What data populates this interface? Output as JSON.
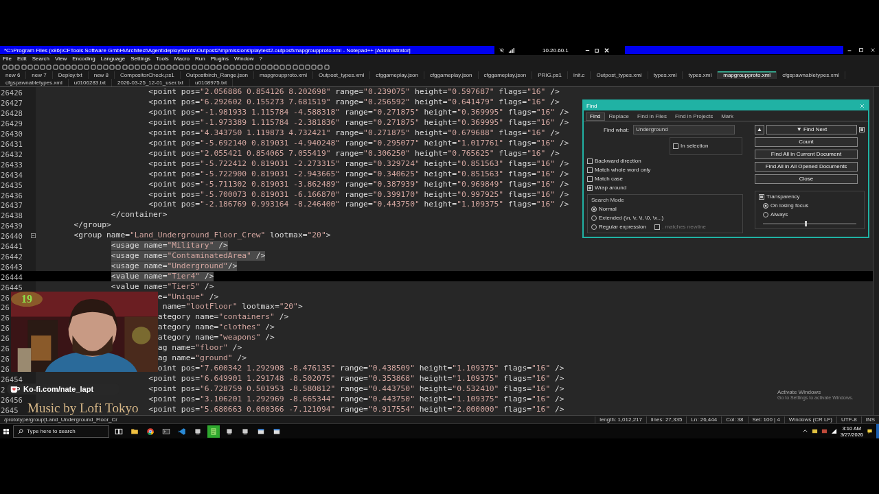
{
  "window": {
    "title": "*C:\\Program Files (x86)\\CFTools Software GmbH\\Architect\\Agent\\deployments\\Outpost2\\mpmissions\\playtest2.outpost\\mapgroupproto.xml - Notepad++ [Administrator]"
  },
  "remote_bar": {
    "address": "10.20.60.1"
  },
  "menu": [
    "File",
    "Edit",
    "Search",
    "View",
    "Encoding",
    "Language",
    "Settings",
    "Tools",
    "Macro",
    "Run",
    "Plugins",
    "Window",
    "?"
  ],
  "tabs": [
    {
      "label": "new 6",
      "selected": false
    },
    {
      "label": "new 7",
      "selected": false
    },
    {
      "label": "Deploy.txt",
      "selected": false
    },
    {
      "label": "new 8",
      "selected": false
    },
    {
      "label": "CompositorCheck.ps1",
      "selected": false
    },
    {
      "label": "Outpostbirch_Range.json",
      "selected": false
    },
    {
      "label": "mapgroupproto.xml",
      "selected": false
    },
    {
      "label": "Outpost_types.xml",
      "selected": false
    },
    {
      "label": "cfggameplay.json",
      "selected": false
    },
    {
      "label": "cfggameplay.json",
      "selected": false
    },
    {
      "label": "cfggameplay.json",
      "selected": false
    },
    {
      "label": "PRIG.ps1",
      "selected": false
    },
    {
      "label": "init.c",
      "selected": false
    },
    {
      "label": "Outpost_types.xml",
      "selected": false
    },
    {
      "label": "types.xml",
      "selected": false
    },
    {
      "label": "types.xml",
      "selected": false
    },
    {
      "label": "mapgroupproto.xml",
      "selected": true
    },
    {
      "label": "cfgspawnabletypes.xml",
      "selected": false
    },
    {
      "label": "cfgspawnabletypes.xml",
      "selected": false
    },
    {
      "label": "u0106283.txt",
      "selected": false
    },
    {
      "label": "2026-03-25_12-01_user.txt",
      "selected": false
    },
    {
      "label": "u0108975.txt",
      "selected": false
    }
  ],
  "lines": [
    {
      "n": "26426",
      "text": "                        <point pos=\"2.056886 0.854126 8.202698\" range=\"0.239075\" height=\"0.597687\" flags=\"16\" />",
      "selected": false,
      "current": false,
      "fold": false
    },
    {
      "n": "26427",
      "text": "                        <point pos=\"6.292602 0.155273 7.681519\" range=\"0.256592\" height=\"0.641479\" flags=\"16\" />",
      "selected": false,
      "current": false,
      "fold": false
    },
    {
      "n": "26428",
      "text": "                        <point pos=\"-1.981933 1.115784 -4.588318\" range=\"0.271875\" height=\"0.369995\" flags=\"16\" />",
      "selected": false,
      "current": false,
      "fold": false
    },
    {
      "n": "26429",
      "text": "                        <point pos=\"-1.973389 1.115784 -2.381836\" range=\"0.271875\" height=\"0.369995\" flags=\"16\" />",
      "selected": false,
      "current": false,
      "fold": false
    },
    {
      "n": "26430",
      "text": "                        <point pos=\"4.343750 1.119873 4.732421\" range=\"0.271875\" height=\"0.679688\" flags=\"16\" />",
      "selected": false,
      "current": false,
      "fold": false
    },
    {
      "n": "26431",
      "text": "                        <point pos=\"-5.692140 0.819031 -4.940248\" range=\"0.295077\" height=\"1.017761\" flags=\"16\" />",
      "selected": false,
      "current": false,
      "fold": false
    },
    {
      "n": "26432",
      "text": "                        <point pos=\"2.055421 0.854065 7.055419\" range=\"0.306250\" height=\"0.765625\" flags=\"16\" />",
      "selected": false,
      "current": false,
      "fold": false
    },
    {
      "n": "26433",
      "text": "                        <point pos=\"-5.722412 0.819031 -2.273315\" range=\"0.329724\" height=\"0.851563\" flags=\"16\" />",
      "selected": false,
      "current": false,
      "fold": false
    },
    {
      "n": "26434",
      "text": "                        <point pos=\"-5.722900 0.819031 -2.943665\" range=\"0.340625\" height=\"0.851563\" flags=\"16\" />",
      "selected": false,
      "current": false,
      "fold": false
    },
    {
      "n": "26435",
      "text": "                        <point pos=\"-5.711302 0.819031 -3.862489\" range=\"0.387939\" height=\"0.969849\" flags=\"16\" />",
      "selected": false,
      "current": false,
      "fold": false
    },
    {
      "n": "26436",
      "text": "                        <point pos=\"-5.700073 0.819031 -6.166870\" range=\"0.399170\" height=\"0.997925\" flags=\"16\" />",
      "selected": false,
      "current": false,
      "fold": false
    },
    {
      "n": "26437",
      "text": "                        <point pos=\"-2.186769 0.993164 -8.246400\" range=\"0.443750\" height=\"1.109375\" flags=\"16\" />",
      "selected": false,
      "current": false,
      "fold": false
    },
    {
      "n": "26438",
      "text": "                </container>",
      "selected": false,
      "current": false,
      "fold": false
    },
    {
      "n": "26439",
      "text": "        </group>",
      "selected": false,
      "current": false,
      "fold": false
    },
    {
      "n": "26440",
      "text": "        <group name=\"Land_Underground_Floor_Crew\" lootmax=\"20\">",
      "selected": false,
      "current": false,
      "fold": true
    },
    {
      "n": "26441",
      "text": "                <usage name=\"Military\" />",
      "selected": true,
      "current": false,
      "fold": false
    },
    {
      "n": "26442",
      "text": "                <usage name=\"ContaminatedArea\" />",
      "selected": true,
      "current": false,
      "fold": false
    },
    {
      "n": "26443",
      "text": "                <usage name=\"Underground\"/>",
      "selected": true,
      "current": false,
      "fold": false
    },
    {
      "n": "26444",
      "text": "                <value name=\"Tier4\" />",
      "selected": true,
      "current": true,
      "fold": false
    },
    {
      "n": "26445",
      "text": "                <value name=\"Tier5\" />",
      "selected": false,
      "current": false,
      "fold": false
    },
    {
      "n": "26",
      "text": "                          e=\"Unique\" />",
      "selected": false,
      "current": false
    },
    {
      "n": "26",
      "text": "                           name=\"lootFloor\" lootmax=\"20\">",
      "selected": false,
      "current": false
    },
    {
      "n": "26",
      "text": "                          ategory name=\"containers\" />",
      "selected": false,
      "current": false
    },
    {
      "n": "26",
      "text": "                          ategory name=\"clothes\" />",
      "selected": false,
      "current": false
    },
    {
      "n": "26",
      "text": "                          ategory name=\"weapons\" />",
      "selected": false,
      "current": false
    },
    {
      "n": "26",
      "text": "                          ag name=\"floor\" />",
      "selected": false,
      "current": false
    },
    {
      "n": "26",
      "text": "                          ag name=\"ground\" />",
      "selected": false,
      "current": false
    },
    {
      "n": "26",
      "text": "                          oint pos=\"7.600342 1.292908 -8.476135\" range=\"0.438509\" height=\"1.109375\" flags=\"16\" />",
      "selected": false,
      "current": false
    },
    {
      "n": "26454",
      "text": "                        <point pos=\"6.649901 1.291748 -8.502075\" range=\"0.353868\" height=\"1.109375\" flags=\"16\" />",
      "selected": false,
      "current": false,
      "fold": false
    },
    {
      "n": "2",
      "text": "                        <point pos=\"6.728759 0.501953 -8.580812\" range=\"0.443750\" height=\"0.532410\" flags=\"16\" />",
      "selected": false,
      "current": false,
      "fold": false
    },
    {
      "n": "26456",
      "text": "                        <point pos=\"3.106201 1.292969 -8.665344\" range=\"0.443750\" height=\"1.109375\" flags=\"16\" />",
      "selected": false,
      "current": false,
      "fold": false
    },
    {
      "n": "2645",
      "text": "                        <point pos=\"5.680663 0.000366 -7.121094\" range=\"0.917554\" height=\"2.000000\" flags=\"16\" />",
      "selected": false,
      "current": false,
      "fold": false
    }
  ],
  "find_dialog": {
    "title": "Find",
    "tabs": [
      {
        "label": "Find",
        "selected": true
      },
      {
        "label": "Replace",
        "selected": false
      },
      {
        "label": "Find in Files",
        "selected": false
      },
      {
        "label": "Find in Projects",
        "selected": false
      },
      {
        "label": "Mark",
        "selected": false
      }
    ],
    "find_what_label": "Find what:",
    "find_what": "Underground",
    "up_button": "▲",
    "find_next": "▼ Find Next",
    "find_next_option": {
      "checked": true
    },
    "in_selection": {
      "label": "In selection",
      "checked": false
    },
    "buttons": [
      "Count",
      "Find All in Current Document",
      "Find All in All Opened Documents",
      "Close"
    ],
    "options": [
      {
        "label": "Backward direction",
        "checked": false
      },
      {
        "label": "Match whole word only",
        "checked": false
      },
      {
        "label": "Match case",
        "checked": false
      },
      {
        "label": "Wrap around",
        "checked": true
      }
    ],
    "search_mode": {
      "title": "Search Mode",
      "modes": [
        {
          "label": "Normal",
          "selected": true
        },
        {
          "label": "Extended (\\n, \\r, \\t, \\0, \\x...)",
          "selected": false
        },
        {
          "label": "Regular expression",
          "selected": false
        }
      ],
      "dot_newline": {
        "label": ". matches newline",
        "checked": false,
        "disabled": true
      }
    },
    "transparency": {
      "label": "Transparency",
      "checked": true,
      "modes": [
        {
          "label": "On losing focus",
          "selected": true
        },
        {
          "label": "Always",
          "selected": false
        }
      ],
      "level": 0.45
    }
  },
  "overlay": {
    "badge": "19",
    "kofi": "Ko-fi.com/nate_lapt",
    "music": "Music by Lofi Tokyo"
  },
  "activation": {
    "title": "Activate Windows",
    "subtitle": "Go to Settings to activate Windows."
  },
  "status_bar": {
    "path": "/prototype/group[Land_Underground_Floor_Cr",
    "length": "length: 1,012,217",
    "lines": "lines: 27,335",
    "position": "Ln: 26,444",
    "column": "Col: 38",
    "selection": "Sel: 100 | 4",
    "eol": "Windows (CR LF)",
    "encoding": "UTF-8",
    "mode": "INS"
  },
  "taskbar": {
    "search_placeholder": "Type here to search",
    "time": "3:10 AM",
    "date": "3/27/2026"
  }
}
